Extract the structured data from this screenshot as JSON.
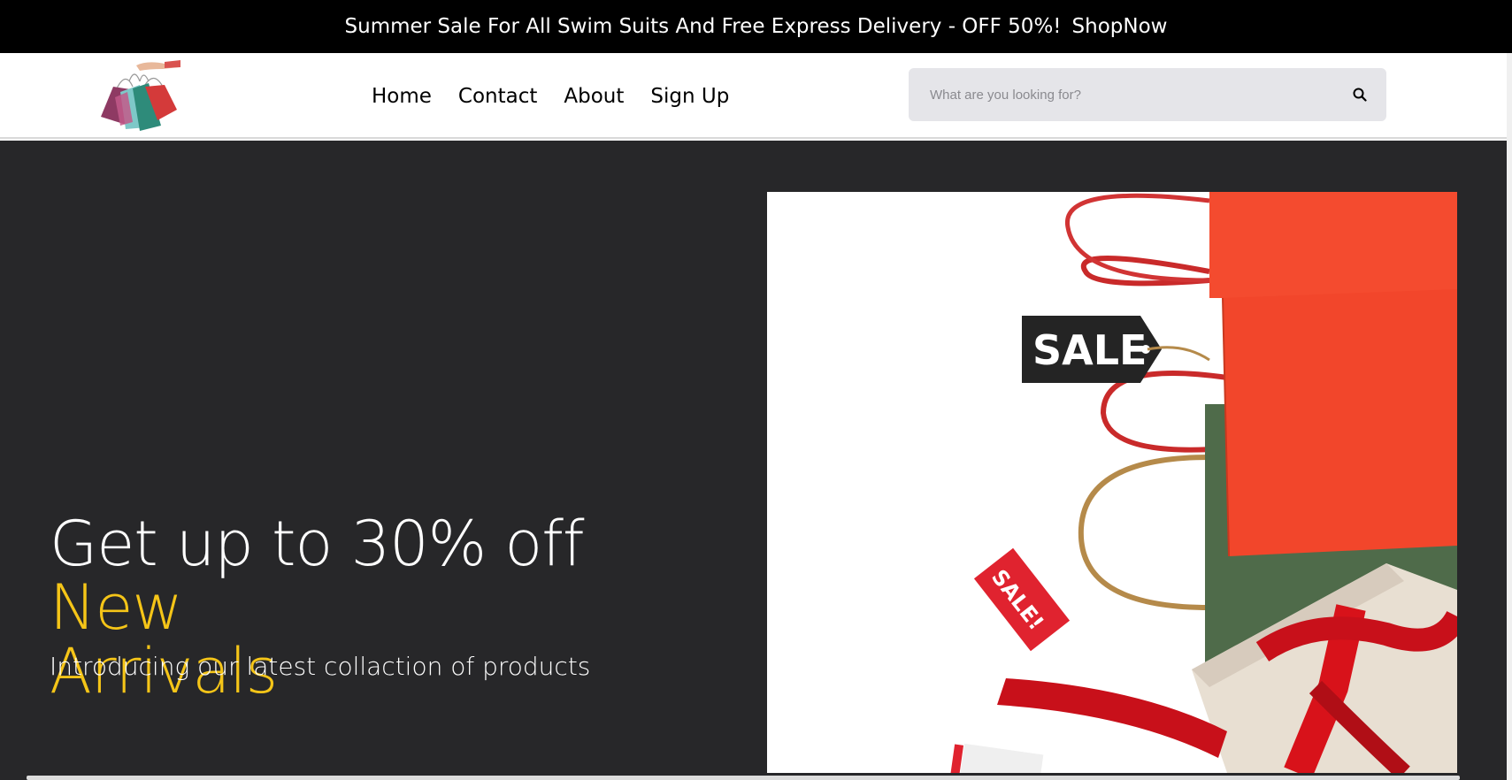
{
  "topbar": {
    "promo_text": "Summer Sale For All Swim Suits And Free Express Delivery - OFF 50%!",
    "shop_link": "ShopNow",
    "background": "#000000"
  },
  "navbar": {
    "logo_icon": "shopping-bags-logo",
    "links": [
      "Home",
      "Contact",
      "About",
      "Sign Up"
    ]
  },
  "search": {
    "placeholder": "What are you looking for?",
    "icon": "search-icon"
  },
  "hero": {
    "heading_white": "Get up to 30% off ",
    "heading_highlight_1": "New",
    "heading_highlight_2": "Arrivals",
    "subheading": "Introducing our latest collaction of products",
    "highlight_color": "#f5c518",
    "background": "#272729",
    "image_tags": [
      "SALE",
      "SALE!"
    ]
  }
}
